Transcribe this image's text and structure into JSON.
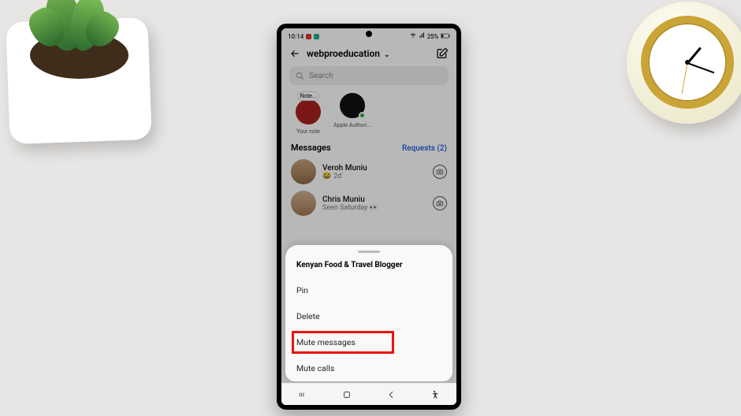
{
  "statusbar": {
    "time": "10:14",
    "battery": "25%"
  },
  "header": {
    "title": "webproeducation"
  },
  "search": {
    "placeholder": "Search"
  },
  "notes": {
    "bubble": "Note...",
    "items": [
      {
        "label": "Your note"
      },
      {
        "label": "Apple Authori..."
      }
    ]
  },
  "section": {
    "label": "Messages",
    "requests": "Requests (2)"
  },
  "messages": [
    {
      "name": "Veroh Muniu",
      "sub": "2d",
      "emoji": "😂"
    },
    {
      "name": "Chris Muniu",
      "sub": "Seen Saturday 👀"
    }
  ],
  "sheet": {
    "title": "Kenyan Food & Travel Blogger",
    "items": [
      "Pin",
      "Delete",
      "Mute messages",
      "Mute calls"
    ],
    "highlighted_index": 2
  }
}
